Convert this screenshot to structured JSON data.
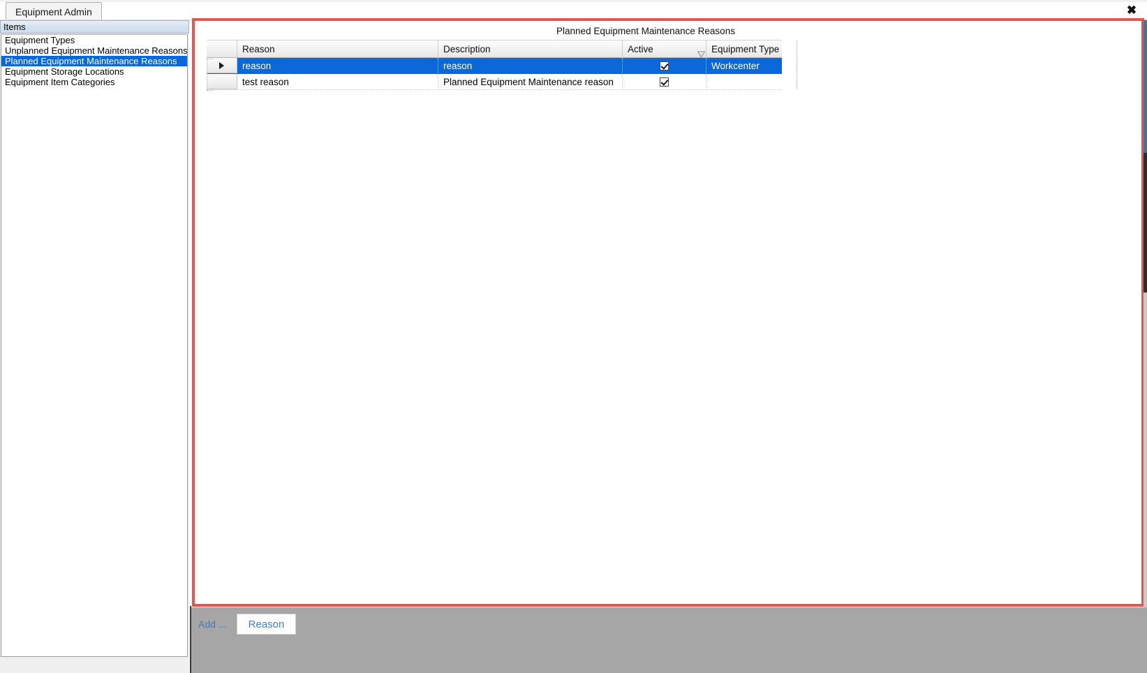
{
  "window": {
    "close_label": "✖"
  },
  "tabs": [
    {
      "label": "Equipment Admin",
      "active": true
    }
  ],
  "sidebar": {
    "header": "Items",
    "items": [
      {
        "label": "Equipment Types",
        "selected": false
      },
      {
        "label": "Unplanned Equipment Maintenance Reasons",
        "selected": false
      },
      {
        "label": "Planned Equipment Maintenance Reasons",
        "selected": true
      },
      {
        "label": "Equipment Storage Locations",
        "selected": false
      },
      {
        "label": "Equipment Item Categories",
        "selected": false
      }
    ]
  },
  "main": {
    "title": "Planned Equipment Maintenance Reasons",
    "grid": {
      "columns": [
        {
          "label": "Reason",
          "sorted": false,
          "sort_direction": ""
        },
        {
          "label": "Description",
          "sorted": false,
          "sort_direction": ""
        },
        {
          "label": "Active",
          "sorted": true,
          "sort_direction": "descending"
        },
        {
          "label": "Equipment Type",
          "sorted": false,
          "sort_direction": ""
        }
      ],
      "rows": [
        {
          "selected": true,
          "current": true,
          "reason": "reason",
          "description": "reason",
          "active": true,
          "equipment_type": "Workcenter"
        },
        {
          "selected": false,
          "current": false,
          "reason": "test reason",
          "description": "Planned Equipment Maintenance reason",
          "active": true,
          "equipment_type": ""
        }
      ]
    }
  },
  "toolbar": {
    "add_label": "Add ...",
    "reason_button_label": "Reason"
  },
  "colors": {
    "selection_blue": "#0a68d8",
    "panel_border_red": "#e8544e",
    "toolbar_grey": "#a6a6a6",
    "link_blue": "#4b77b5",
    "button_text_blue": "#3f7fd0"
  }
}
